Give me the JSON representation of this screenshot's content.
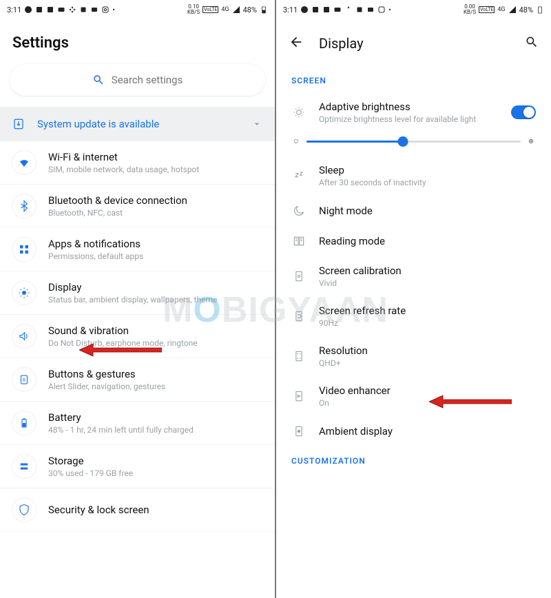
{
  "status": {
    "time": "3:11",
    "kbs_left": "0.10",
    "kbs_right": "0.00",
    "kbs_unit": "KB/S",
    "volte": "VoLTE",
    "sig": "4G",
    "battery": "48%"
  },
  "left": {
    "title": "Settings",
    "search_placeholder": "Search settings",
    "system_update": "System update is available",
    "items": [
      {
        "title": "Wi-Fi & internet",
        "sub": "SIM, mobile network, data usage, hotspot"
      },
      {
        "title": "Bluetooth & device connection",
        "sub": "Bluetooth, NFC, cast"
      },
      {
        "title": "Apps & notifications",
        "sub": "Permissions, default apps"
      },
      {
        "title": "Display",
        "sub": "Status bar, ambient display, wallpapers, theme"
      },
      {
        "title": "Sound & vibration",
        "sub": "Do Not Disturb, earphone mode, ringtone"
      },
      {
        "title": "Buttons & gestures",
        "sub": "Alert Slider, navigation, gestures"
      },
      {
        "title": "Battery",
        "sub": "48% - 1 hr, 24 min left until fully charged"
      },
      {
        "title": "Storage",
        "sub": "30% used - 179 GB free"
      },
      {
        "title": "Security & lock screen",
        "sub": ""
      }
    ]
  },
  "right": {
    "title": "Display",
    "section_screen": "SCREEN",
    "adaptive": {
      "title": "Adaptive brightness",
      "sub": "Optimize brightness level for available light"
    },
    "sleep": {
      "title": "Sleep",
      "sub": "After 30 seconds of inactivity"
    },
    "night": "Night mode",
    "reading": "Reading mode",
    "calib": {
      "title": "Screen calibration",
      "sub": "Vivid"
    },
    "refresh": {
      "title": "Screen refresh rate",
      "sub": "90Hz"
    },
    "resolution": {
      "title": "Resolution",
      "sub": "QHD+"
    },
    "video": {
      "title": "Video enhancer",
      "sub": "On"
    },
    "ambient": "Ambient display",
    "section_custom": "CUSTOMIZATION"
  },
  "watermark": "MOBIGYAAN"
}
